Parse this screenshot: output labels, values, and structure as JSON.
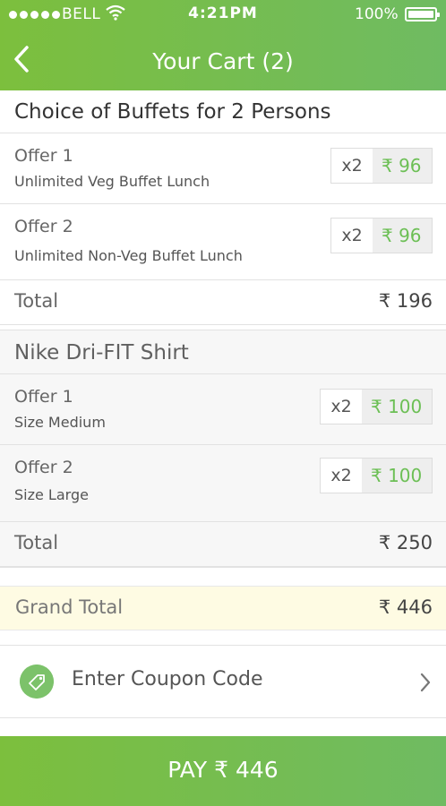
{
  "status_bar": {
    "carrier": "BELL",
    "time": "4:21PM",
    "battery": "100%"
  },
  "header": {
    "title": "Your Cart (2)",
    "back_icon": "chevron-left-icon"
  },
  "cart": {
    "sections": [
      {
        "name": "Choice of Buffets for 2 Persons",
        "offers": [
          {
            "title": "Offer 1",
            "description": "Unlimited Veg Buffet Lunch",
            "quantity": "x2",
            "price": "₹ 96"
          },
          {
            "title": "Offer 2",
            "description": "Unlimited Non-Veg Buffet Lunch",
            "quantity": "x2",
            "price": "₹ 96"
          }
        ],
        "total_label": "Total",
        "total_value": "₹ 196"
      },
      {
        "name": "Nike Dri-FIT Shirt",
        "offers": [
          {
            "title": "Offer 1",
            "description": "Size Medium",
            "quantity": "x2",
            "price": "₹ 100"
          },
          {
            "title": "Offer 2",
            "description": "Size Large",
            "quantity": "x2",
            "price": "₹ 100"
          }
        ],
        "total_label": "Total",
        "total_value": "₹ 250"
      }
    ],
    "grand_total_label": "Grand Total",
    "grand_total_value": "₹ 446"
  },
  "coupon": {
    "label": "Enter Coupon Code",
    "icon": "tag-icon"
  },
  "pay_button": {
    "label": "PAY ₹ 446"
  },
  "colors": {
    "accent_green": "#7cbf3d",
    "price_green": "#6cbf55",
    "grand_total_bg": "#fefbe3"
  }
}
